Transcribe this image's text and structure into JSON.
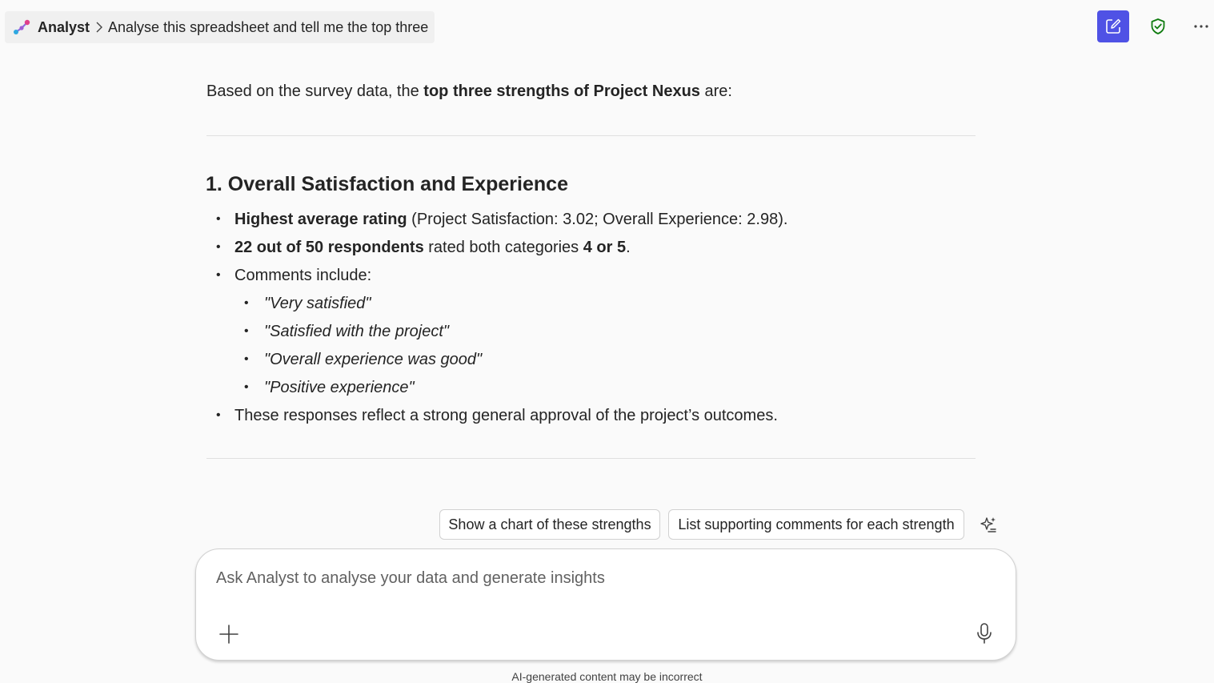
{
  "header": {
    "app_name": "Analyst",
    "conversation_title": "Analyse this spreadsheet and tell me the top three"
  },
  "message": {
    "intro_prefix": "Based on the survey data, the ",
    "intro_bold": "top three strengths of Project Nexus",
    "intro_suffix": " are:",
    "section_heading": "1. Overall Satisfaction and Experience",
    "bullet1_bold": "Highest average rating",
    "bullet1_text": " (Project Satisfaction: 3.02; Overall Experience: 2.98).",
    "bullet2_bold": "22 out of 50 respondents",
    "bullet2_text": " rated both categories ",
    "bullet2_bold2": "4 or 5",
    "bullet2_end": ".",
    "bullet3_text": "Comments include:",
    "comments": [
      "\"Very satisfied\"",
      "\"Satisfied with the project\"",
      "\"Overall experience was good\"",
      "\"Positive experience\""
    ],
    "bullet4_text": "These responses reflect a strong general approval of the project’s outcomes."
  },
  "suggestions": [
    "Show a chart of these strengths",
    "List supporting comments for each strength"
  ],
  "input": {
    "placeholder": "Ask Analyst to analyse your data and generate insights"
  },
  "disclaimer": "AI-generated content may be incorrect",
  "colors": {
    "accent": "#4f52e5",
    "shield": "#107c10",
    "background": "#fafafa"
  },
  "icons": [
    "analyst-logo-icon",
    "chevron-right-icon",
    "new-chat-icon",
    "shield-check-icon",
    "more-icon",
    "sparkle-icon",
    "plus-icon",
    "microphone-icon"
  ]
}
